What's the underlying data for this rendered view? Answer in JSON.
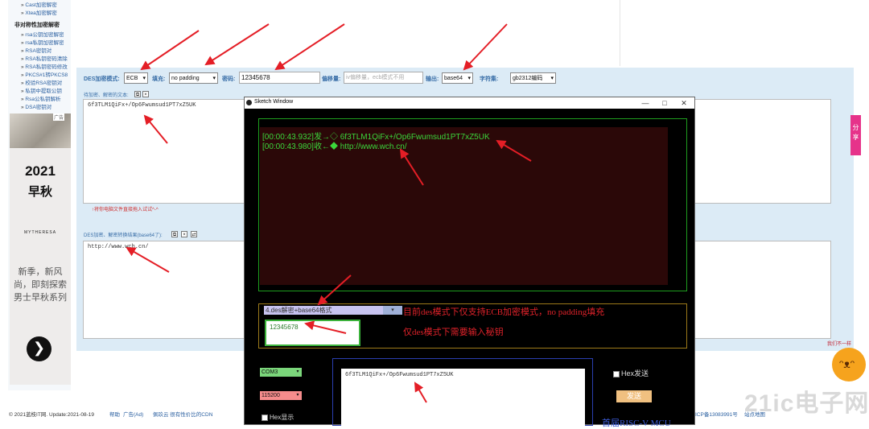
{
  "sidebar": {
    "links_top": [
      "Cast加密解密",
      "Xtea加密解密"
    ],
    "section_title": "非对称性加密解密",
    "links": [
      "rsa公钥加密解密",
      "rsa私钥加密解密",
      "RSA密钥对",
      "RSA私钥密码清除",
      "RSA私钥密码修改",
      "PKCS#1转PKCS8",
      "校验RSA密钥对",
      "私钥中提取公钥",
      "Rsa公私钥解析",
      "DSA密钥对"
    ]
  },
  "ad": {
    "tag": "广告",
    "year": "2021",
    "season": "早秋",
    "brand": "MYTHERESA",
    "copy": "新季，新风尚，即刻探索男士早秋系列",
    "next_glyph": "❯"
  },
  "form": {
    "mode_label": "DES加密模式:",
    "mode_value": "ECB",
    "padding_label": "填充:",
    "padding_value": "no padding",
    "key_label": "密码:",
    "key_value": "12345678",
    "iv_label": "偏移量:",
    "iv_placeholder": "iv偏移量，ecb模式不用",
    "output_label": "输出:",
    "output_value": "base64",
    "charset_label": "字符集:",
    "charset_value": "gb2312编码",
    "plaintext_label": "待加密、解密的文本:",
    "plaintext_value": "6f3TLM1QiFx+/Op6Fwumsud1PT7xZ5UK",
    "drag_hint": "↑将你电脑文件直接拖入试试^-^",
    "result_label": "DES加密、解密转换结果(base64了):",
    "result_value": "http://www.wch.cn/"
  },
  "footer": {
    "copyright": "© 2021蓝枝IT网. Update:2021-08-19",
    "help": "帮助",
    "ads": "广告(Ad)",
    "cdn": "佩玖云  很有性价比的CDN",
    "icp": "ICP备13083991号",
    "sitemap": "站点地图"
  },
  "sketch_window": {
    "title": "Sketch Window",
    "log_lines": [
      {
        "time": "[00:00:43.932]",
        "dir": "发→◇",
        "text": "6f3TLM1QiFx+/Op6Fwumsud1PT7xZ5UK"
      },
      {
        "time": "[00:00:43.980]",
        "dir": "收←◆",
        "text": "http://www.wch.cn/"
      }
    ],
    "mode_select": "4.des解密+base64格式",
    "mode_note_1": "目前des模式下仅支持ECB加密模式，no padding填充",
    "mode_note_2": "仅des模式下需要输入秘钥",
    "key": "12345678",
    "com_port": "COM3",
    "baud": "115200",
    "hex_show": "Hex显示",
    "send_text": "6f3TLM1QiFx+/Op6Fwumsud1PT7xZ5UK",
    "hex_send": "Hex发送",
    "send_button": "发送",
    "brand_text": "首届RISC-V MCU"
  },
  "share_tab": "分享",
  "mascot_bubble": "我们不一样",
  "watermark": "21ic电子网",
  "colors": {
    "panel_bg": "#dcebf6",
    "log_green": "#3bd63b",
    "note_red": "#e0222a",
    "annotation_arrow": "#e41e26"
  }
}
